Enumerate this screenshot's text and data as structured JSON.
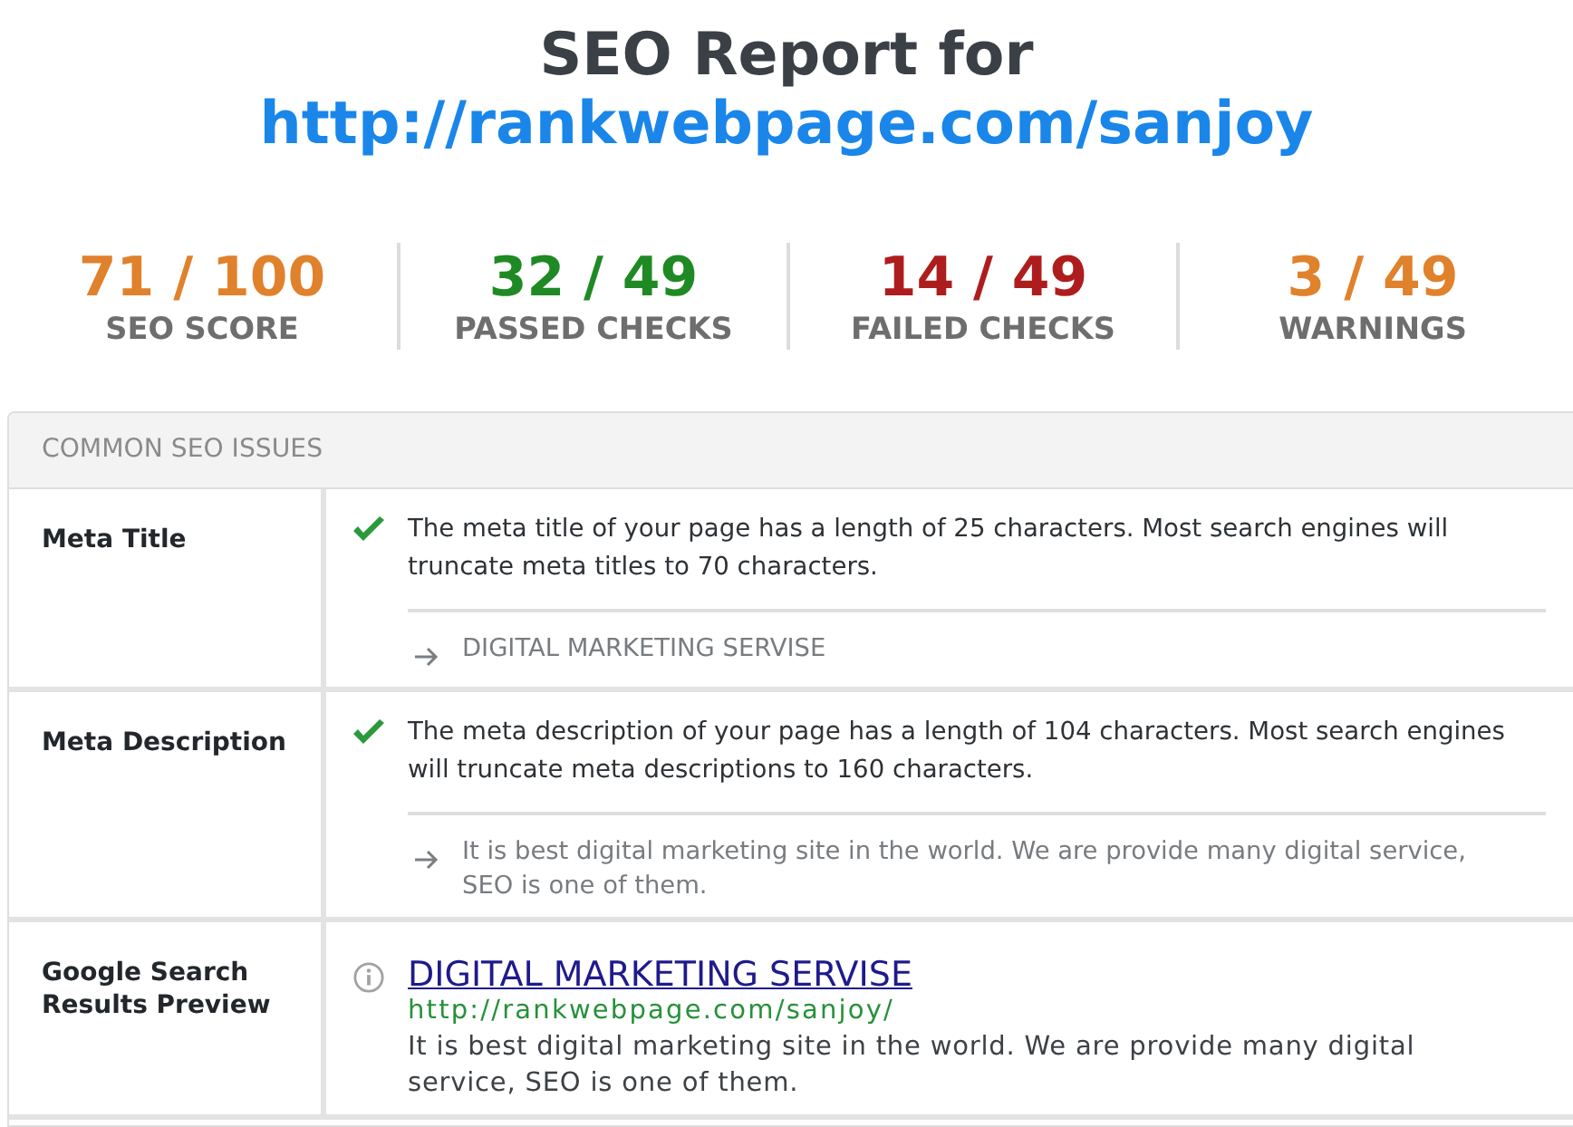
{
  "header": {
    "title": "SEO Report for",
    "url": "http://rankwebpage.com/sanjoy"
  },
  "stats": [
    {
      "value": "71 / 100",
      "label": "SEO SCORE",
      "color": "#e0812c"
    },
    {
      "value": "32 / 49",
      "label": "PASSED CHECKS",
      "color": "#1f8a24"
    },
    {
      "value": "14 / 49",
      "label": "FAILED CHECKS",
      "color": "#ae1d1d"
    },
    {
      "value": "3 / 49",
      "label": "WARNINGS",
      "color": "#e0812c"
    }
  ],
  "panel": {
    "title": "COMMON SEO ISSUES",
    "rows": [
      {
        "label": "Meta Title",
        "kind": "check",
        "message": "The meta title of your page has a length of 25 characters. Most search engines will truncate meta titles to 70 characters.",
        "detail": "DIGITAL MARKETING SERVISE"
      },
      {
        "label": "Meta Description",
        "kind": "check",
        "message": "The meta description of your page has a length of 104 characters. Most search engines will truncate meta descriptions to 160 characters.",
        "detail": "It is best digital marketing site in the world. We are provide many digital service, SEO is one of them."
      },
      {
        "label": "Google Search Results Preview",
        "kind": "preview",
        "preview": {
          "title": "DIGITAL MARKETING SERVISE",
          "url": "http://rankwebpage.com/sanjoy/",
          "description": "It is best digital marketing site in the world. We are provide many digital service, SEO is one of them."
        }
      }
    ]
  }
}
